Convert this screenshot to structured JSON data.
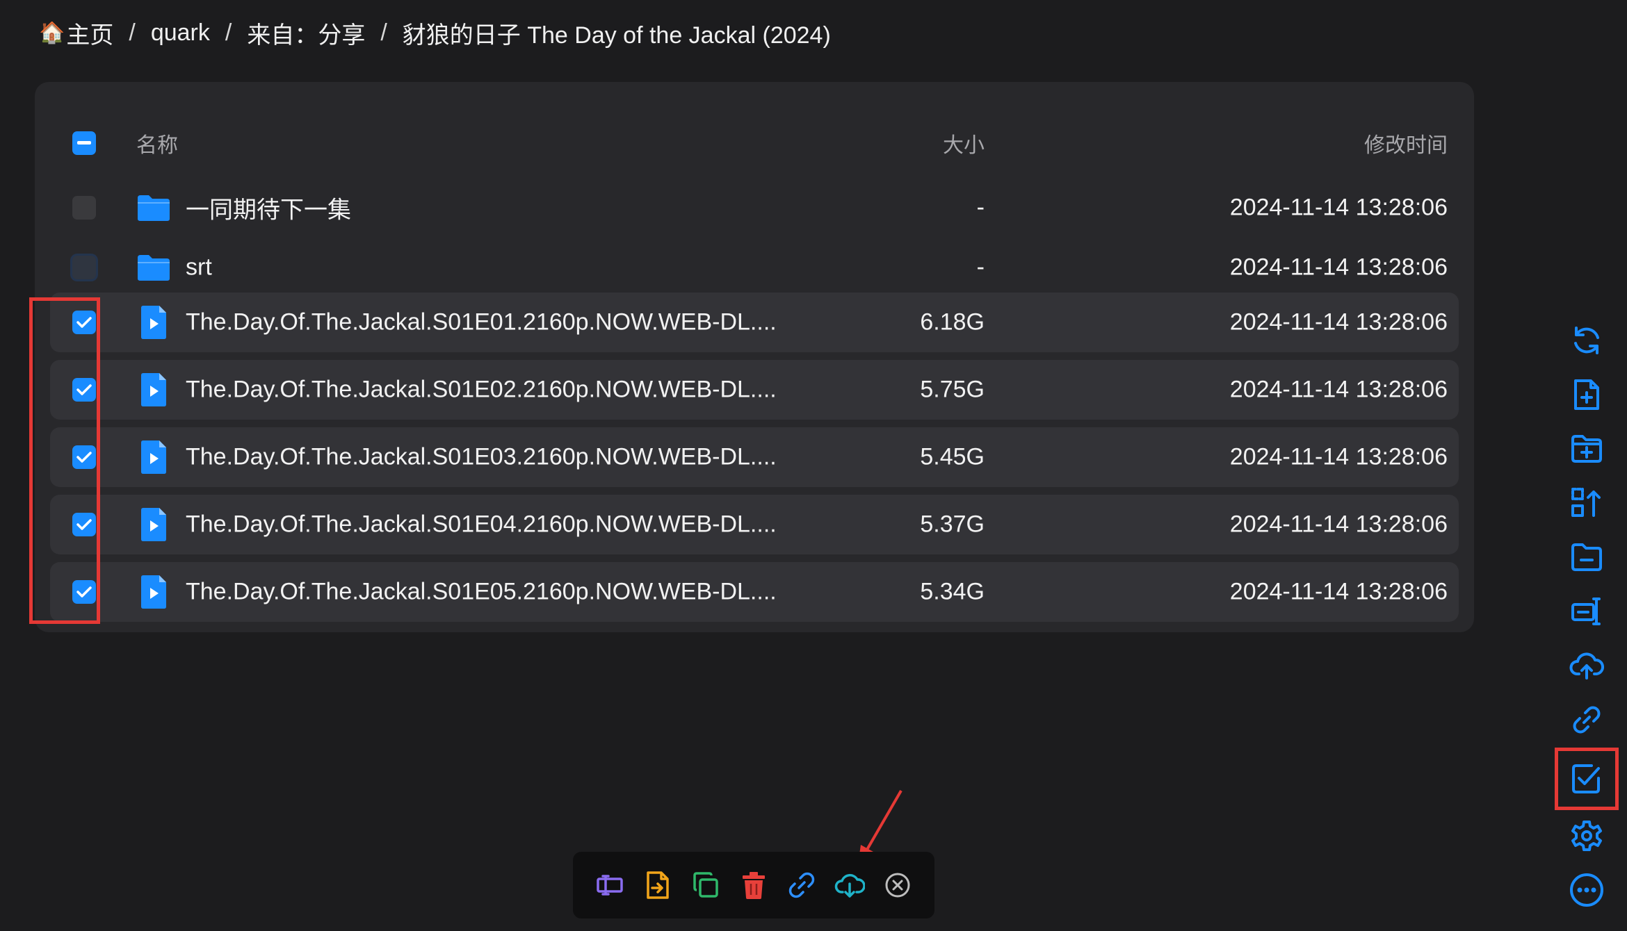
{
  "breadcrumb": {
    "home_glyph": "🏠",
    "items": [
      "主页",
      "quark",
      "来自：分享",
      "豺狼的日子 The Day of the Jackal (2024)"
    ],
    "separator": "/"
  },
  "table": {
    "columns": {
      "name": "名称",
      "size": "大小",
      "modified": "修改时间"
    },
    "rows": [
      {
        "type": "folder",
        "name": "一同期待下一集",
        "size": "-",
        "modified": "2024-11-14 13:28:06",
        "checked": false
      },
      {
        "type": "folder",
        "name": "srt",
        "size": "-",
        "modified": "2024-11-14 13:28:06",
        "checked": false
      },
      {
        "type": "video",
        "name": "The.Day.Of.The.Jackal.S01E01.2160p.NOW.WEB-DL....",
        "size": "6.18G",
        "modified": "2024-11-14 13:28:06",
        "checked": true
      },
      {
        "type": "video",
        "name": "The.Day.Of.The.Jackal.S01E02.2160p.NOW.WEB-DL....",
        "size": "5.75G",
        "modified": "2024-11-14 13:28:06",
        "checked": true
      },
      {
        "type": "video",
        "name": "The.Day.Of.The.Jackal.S01E03.2160p.NOW.WEB-DL....",
        "size": "5.45G",
        "modified": "2024-11-14 13:28:06",
        "checked": true
      },
      {
        "type": "video",
        "name": "The.Day.Of.The.Jackal.S01E04.2160p.NOW.WEB-DL....",
        "size": "5.37G",
        "modified": "2024-11-14 13:28:06",
        "checked": true
      },
      {
        "type": "video",
        "name": "The.Day.Of.The.Jackal.S01E05.2160p.NOW.WEB-DL....",
        "size": "5.34G",
        "modified": "2024-11-14 13:28:06",
        "checked": true
      }
    ]
  },
  "sidebar_icons": [
    "refresh-icon",
    "new-file-icon",
    "new-folder-icon",
    "sort-icon",
    "folder-minus-icon",
    "transfer-icon",
    "cloud-upload-icon",
    "link-icon",
    "multi-select-icon",
    "settings-icon",
    "more-icon"
  ],
  "action_bar_icons": [
    "rename-icon",
    "move-icon",
    "copy-icon",
    "delete-icon",
    "share-link-icon",
    "cloud-download-icon",
    "close-icon"
  ],
  "colors": {
    "accent": "#1a8cff",
    "highlight": "#e53935",
    "background": "#1c1c1e",
    "panel": "#28282b"
  }
}
